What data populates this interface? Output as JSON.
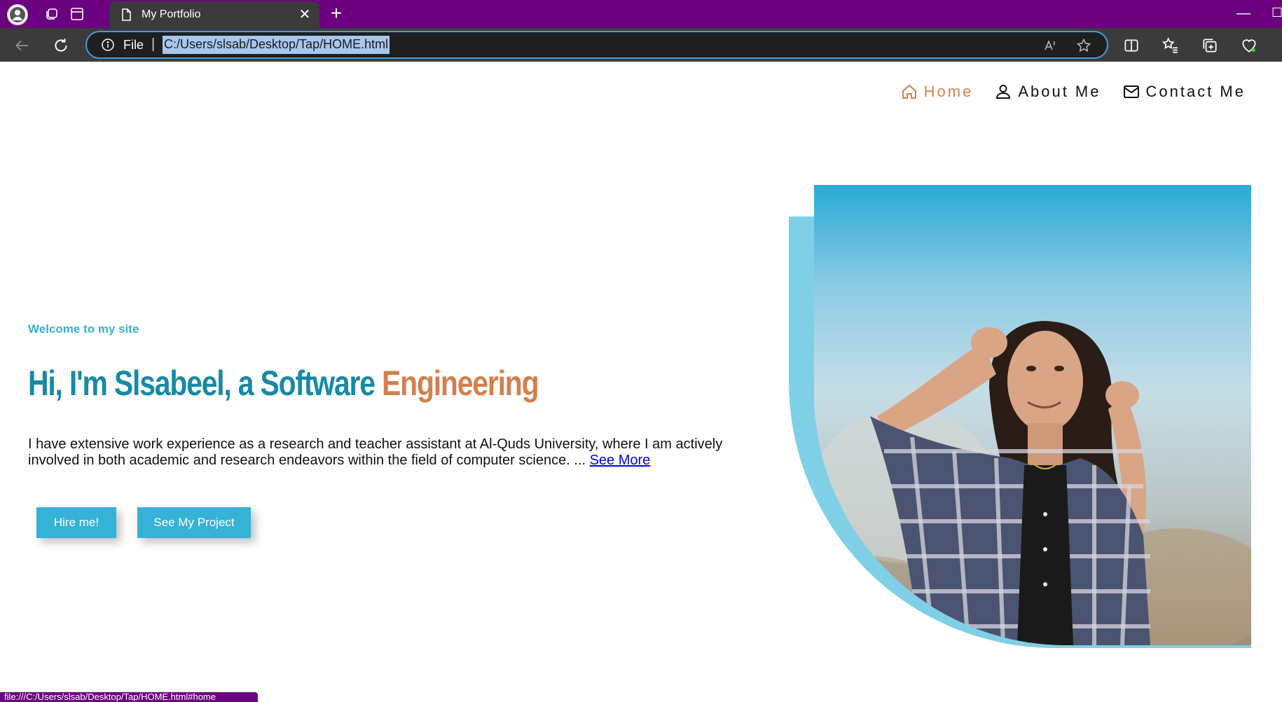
{
  "browser": {
    "tab_title": "My Portfolio",
    "close_glyph": "✕",
    "new_tab_glyph": "+",
    "minimize_glyph": "—",
    "maximize_glyph": "☐",
    "scheme_label": "File",
    "separator": "|",
    "url": "C:/Users/slsab/Desktop/Tap/HOME.html",
    "status_url": "file:///C:/Users/slsab/Desktop/Tap/HOME.html#home"
  },
  "nav": {
    "items": [
      {
        "label": "Home",
        "icon": "home-icon",
        "active": true
      },
      {
        "label": "About Me",
        "icon": "user-icon",
        "active": false
      },
      {
        "label": "Contact Me",
        "icon": "mail-icon",
        "active": false
      }
    ]
  },
  "hero": {
    "welcome": "Welcome to my site",
    "headline_main": "Hi, I'm Slsabeel, a Software",
    "headline_accent": "Engineering",
    "intro": "I have extensive work experience as a research and teacher assistant at Al-Quds University, where I am actively involved in both academic and research endeavors within the field of computer science. ...",
    "see_more": "See More",
    "hire_button": "Hire me!",
    "project_button": "See My Project"
  },
  "colors": {
    "title_bar": "#6b0080",
    "primary": "#178aa6",
    "accent": "#d4804c",
    "button": "#35b2d6",
    "photo_frame": "#7fd0e6"
  }
}
